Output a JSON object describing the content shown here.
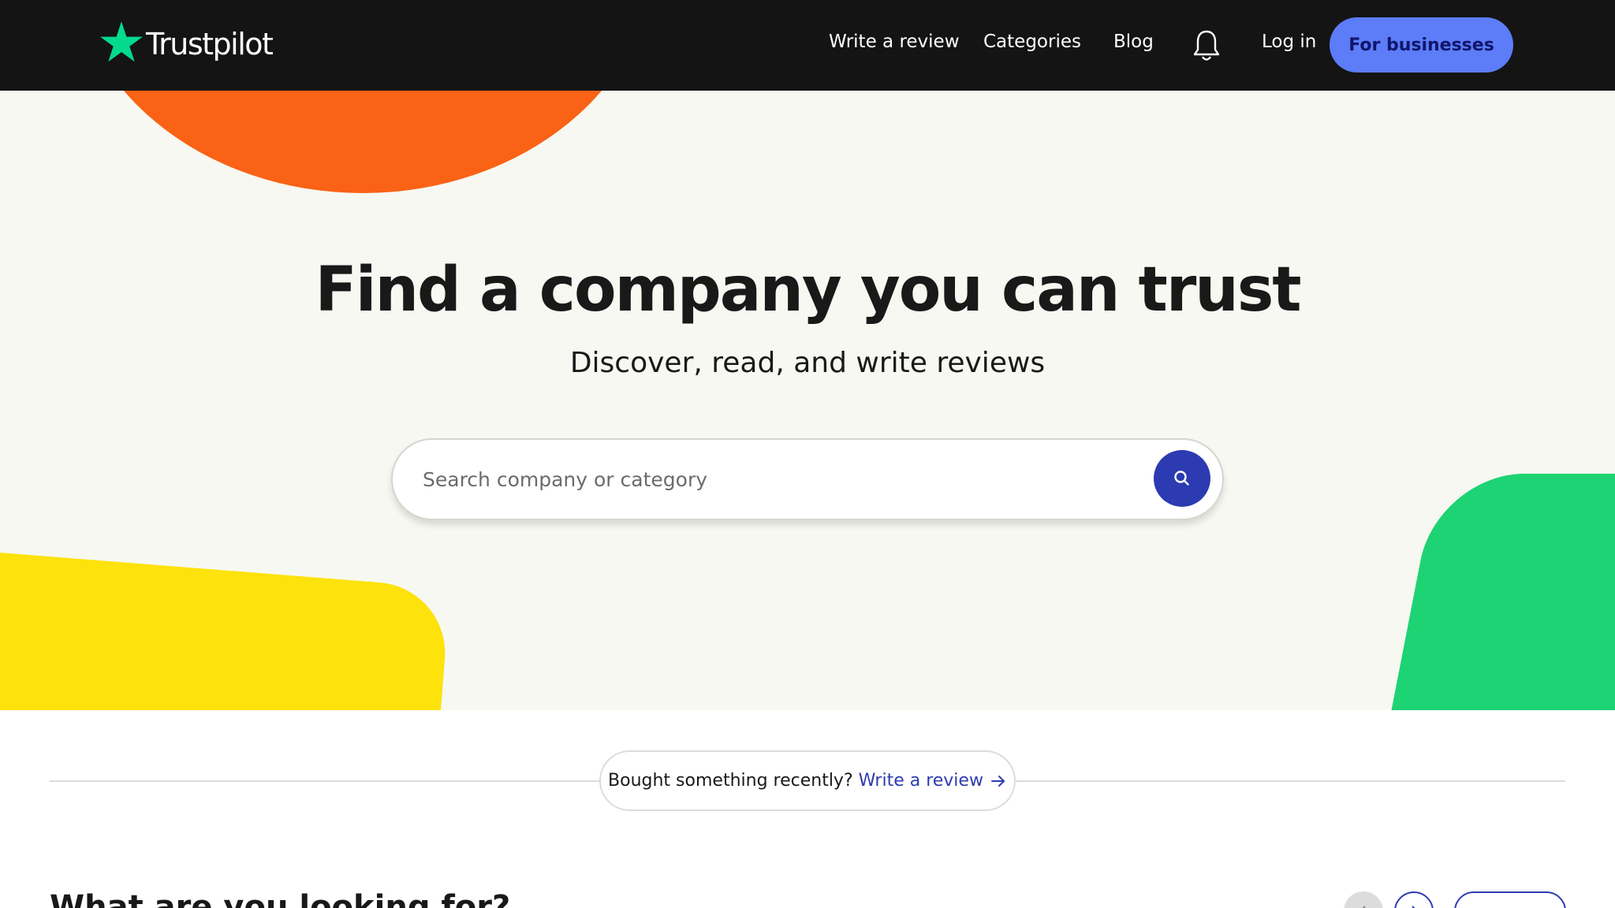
{
  "header": {
    "logo_text": "Trustpilot",
    "nav": {
      "write_review": "Write a review",
      "categories": "Categories",
      "blog": "Blog",
      "login": "Log in"
    },
    "cta_label": "For businesses",
    "icons": [
      "star-logo-icon",
      "bell-icon"
    ]
  },
  "hero": {
    "title": "Find a company you can trust",
    "subtitle": "Discover, read, and write reviews",
    "search": {
      "placeholder": "Search company or category",
      "value": "",
      "button_icon": "search-icon"
    }
  },
  "recent": {
    "text": "Bought something recently?",
    "link_label": "Write a review",
    "link_icon": "arrow-right-icon"
  },
  "section": {
    "title": "What are you looking for?",
    "controls": [
      "chevron-left-icon",
      "chevron-right-icon"
    ]
  },
  "colors": {
    "header_bg": "#141414",
    "cta_bg": "#5c7cf8",
    "accent_blue": "#2c3bb1",
    "hero_bg": "#f7f8f1",
    "orange": "#fa6216",
    "yellow": "#fde20b",
    "green": "#1ed373",
    "brand_star": "#04da8d"
  }
}
